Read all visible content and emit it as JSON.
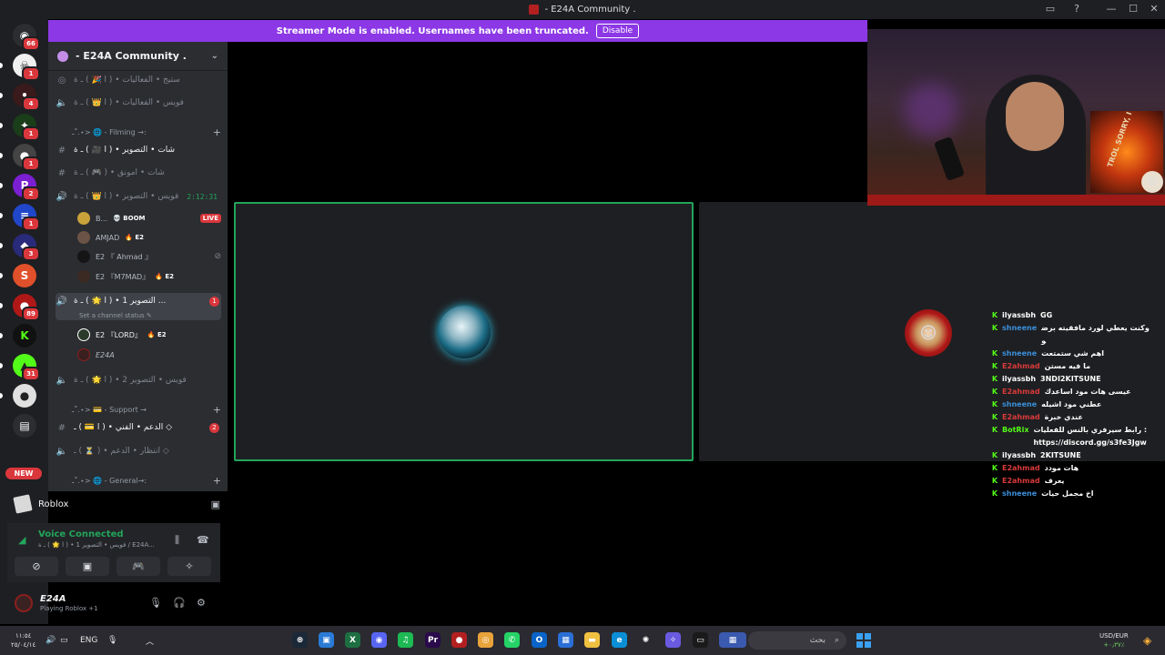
{
  "window": {
    "title": "- E24A Community ."
  },
  "banner": {
    "text": "Streamer Mode is enabled. Usernames have been truncated.",
    "button": "Disable"
  },
  "rail": {
    "servers": [
      {
        "icon": "discord-home-icon",
        "glyph": "◉",
        "color": "#2b2d31",
        "badge": "66"
      },
      {
        "icon": "server-skull-icon",
        "glyph": "☠",
        "color": "#f0f0f0",
        "badge": "1"
      },
      {
        "icon": "server-dark-icon",
        "glyph": "•",
        "color": "#3a1a1a",
        "badge": "4"
      },
      {
        "icon": "server-green-icon",
        "glyph": "✦",
        "color": "#1a3d1a",
        "badge": "1"
      },
      {
        "icon": "server-purple-icon",
        "glyph": "●",
        "color": "#444",
        "badge": "1"
      },
      {
        "icon": "server-p-icon",
        "glyph": "P",
        "color": "#7a1fd1",
        "badge": "2"
      },
      {
        "icon": "server-stack-icon",
        "glyph": "≡",
        "color": "#2046c9",
        "badge": "1"
      },
      {
        "icon": "server-blue-icon",
        "glyph": "◆",
        "color": "#2a2a7a",
        "badge": "3"
      },
      {
        "icon": "server-s-icon",
        "glyph": "S",
        "color": "#e0502a",
        "badge": ""
      },
      {
        "icon": "server-red-icon",
        "glyph": "●",
        "color": "#b01818",
        "badge": "89"
      },
      {
        "icon": "server-kick-icon",
        "glyph": "K",
        "color": "#111",
        "badge": ""
      },
      {
        "icon": "server-lime-icon",
        "glyph": "▲",
        "color": "#53fc18",
        "badge": "31"
      },
      {
        "icon": "server-white-icon",
        "glyph": "●",
        "color": "#e0e0e0",
        "badge": ""
      },
      {
        "icon": "server-folder-icon",
        "glyph": "▤",
        "color": "#2b2d31",
        "badge": ""
      }
    ],
    "new_label": "NEW"
  },
  "guild": {
    "name": "- E24A Community ."
  },
  "channels": {
    "stage": "ستيج • الفعاليات • ( ا 🎉 ) ـ ة",
    "voice_events": "فويس • الفعاليات • ( ا 👑 ) ـ ة",
    "cat_filming": "ـ˚.⋆> 🌐 - Filming →:",
    "chat_photo": "شات • التصوير • ( ا 🎥 ) ـ ة",
    "chat_live": "شات • امونق • ( 🎮 ) ـ ة",
    "voice_photo": "فويس • التصوير • ( ا 👑 ) ـ ة",
    "voice_photo_time": "2:12:31",
    "voice_photo1": "التصوير 1 • ( ا 🌟 ) ـ ة ...",
    "voice_photo1_badge": "1",
    "voice_photo1_status": "Set a channel status",
    "voice_photo2": "فويس • التصوير 2 • ( ا 🌟 ) ـ ة",
    "cat_support": "ـ˚.⋆> 💳 - Support →",
    "support_text": "الدعم • الفني • ( ا 💳 ) ـ ◇",
    "support_badge": "2",
    "support_wait": "انتظار • الدعم • ( ⏳ ) ـ ◇",
    "cat_general": "ـ˚.⋆> 🌐 - General→:"
  },
  "voice_users": {
    "boom_name": "B...",
    "boom_tag": "💀 BOOM",
    "boom_live": "LIVE",
    "amjad": "AMJAD",
    "amjad_tag": "🔥 E2",
    "ahmad": "E2 『 Ahmad 』",
    "m7mad": "E2 『M7MAD』",
    "m7mad_tag": "🔥 E2",
    "lord": "E2 『LORD』",
    "lord_tag": "🔥 E2",
    "e24a": "E24A"
  },
  "activity": {
    "name": "Roblox"
  },
  "voice_panel": {
    "title": "Voice Connected",
    "subtitle": "فويس • التصوير 1 • ( ا 🌟 ) ـ ة / E24A..."
  },
  "user": {
    "name": "E24A",
    "status": "Playing Roblox +1"
  },
  "webcam": {
    "overlay_text": "TROL SORRY, I"
  },
  "chat": [
    {
      "user": "ilyassbh",
      "color": "#ffffff",
      "msg": "GG"
    },
    {
      "user": "shneene",
      "color": "#3a8fd9",
      "msg": "وكنت يعطي لورد مافقيته برضو"
    },
    {
      "user": "shneene",
      "color": "#3a8fd9",
      "msg": "اهم شي ستمتعت"
    },
    {
      "user": "E2ahmad",
      "color": "#d93a3a",
      "msg": "ما فيه مستن"
    },
    {
      "user": "ilyassbh",
      "color": "#ffffff",
      "msg": "3NDI2KITSUNE"
    },
    {
      "user": "E2ahmad",
      "color": "#d93a3a",
      "msg": "عيسى هات مود اساعدك"
    },
    {
      "user": "shneene",
      "color": "#3a8fd9",
      "msg": "عطني مود اشيله"
    },
    {
      "user": "E2ahmad",
      "color": "#d93a3a",
      "msg": "عندي خبرة"
    },
    {
      "user": "BotRix",
      "color": "#53fc18",
      "msg": "رابط سيرفري بالنس للفعليات : https://discord.gg/s3fe3Jgw"
    },
    {
      "user": "ilyassbh",
      "color": "#ffffff",
      "msg": "2KITSUNE"
    },
    {
      "user": "E2ahmad",
      "color": "#d93a3a",
      "msg": "هات مودد"
    },
    {
      "user": "E2ahmad",
      "color": "#d93a3a",
      "msg": "يعرف"
    },
    {
      "user": "shneene",
      "color": "#3a8fd9",
      "msg": "اخ مجمل حيات"
    }
  ],
  "taskbar": {
    "time": "١١:٥٤",
    "date": "٢٥/٠٤/١٤",
    "lang": "ENG",
    "search_placeholder": "بحث",
    "currency": "USD/EUR",
    "currency_change": "+٠٫٣٧٪",
    "apps": [
      {
        "icon": "steam-icon",
        "glyph": "⊛",
        "color": "#1b2838"
      },
      {
        "icon": "notepad-icon",
        "glyph": "▣",
        "color": "#2a7bd6"
      },
      {
        "icon": "excel-icon",
        "glyph": "X",
        "color": "#1d6f42"
      },
      {
        "icon": "discord-icon",
        "glyph": "◉",
        "color": "#5865f2"
      },
      {
        "icon": "spotify-icon",
        "glyph": "♫",
        "color": "#1db954"
      },
      {
        "icon": "premiere-icon",
        "glyph": "Pr",
        "color": "#2a0a4a"
      },
      {
        "icon": "roblox-icon",
        "glyph": "●",
        "color": "#b32020"
      },
      {
        "icon": "chrome-icon",
        "glyph": "◎",
        "color": "#e8a33a"
      },
      {
        "icon": "whatsapp-icon",
        "glyph": "✆",
        "color": "#25d366"
      },
      {
        "icon": "outlook-icon",
        "glyph": "O",
        "color": "#0a64c8"
      },
      {
        "icon": "store-icon",
        "glyph": "▦",
        "color": "#2a6fd6"
      },
      {
        "icon": "explorer-icon",
        "glyph": "▬",
        "color": "#f0c040"
      },
      {
        "icon": "edge-icon",
        "glyph": "e",
        "color": "#0a8fd6"
      },
      {
        "icon": "chatgpt-icon",
        "glyph": "✺",
        "color": "#2a2a30"
      },
      {
        "icon": "copilot-icon",
        "glyph": "✧",
        "color": "#6a5ae0"
      },
      {
        "icon": "terminal-icon",
        "glyph": "▭",
        "color": "#1a1a1a"
      }
    ]
  }
}
